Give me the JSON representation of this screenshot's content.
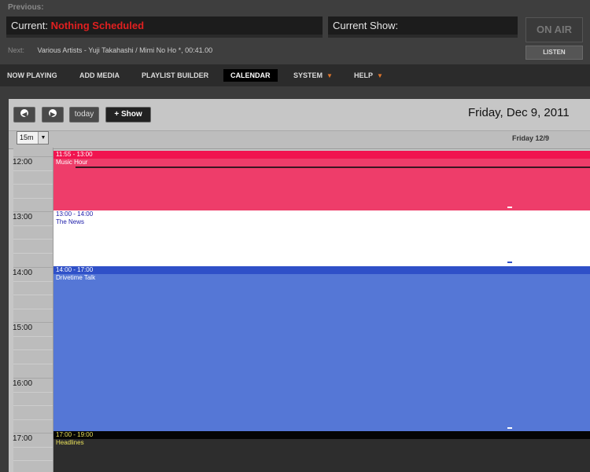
{
  "header": {
    "previous_label": "Previous:",
    "current_label": "Current:",
    "current_value": "Nothing Scheduled",
    "current_show_label": "Current Show:",
    "next_label": "Next:",
    "next_value": "Various Artists - Yuji Takahashi / Mimi No Ho *, 00:41.00",
    "on_air": "ON AIR",
    "listen": "LISTEN"
  },
  "menu": [
    {
      "label": "NOW PLAYING"
    },
    {
      "label": "ADD MEDIA"
    },
    {
      "label": "PLAYLIST BUILDER"
    },
    {
      "label": "CALENDAR",
      "active": true
    },
    {
      "label": "SYSTEM",
      "dropdown": true
    },
    {
      "label": "HELP",
      "dropdown": true
    }
  ],
  "toolbar": {
    "prev_icon": "prev-icon",
    "next_icon": "next-icon",
    "today": "today",
    "add_show": "Show",
    "date_title": "Friday, Dec 9, 2011"
  },
  "calendar": {
    "zoom": "15m",
    "day_header": "Friday 12/9",
    "hours": [
      "12:00",
      "13:00",
      "14:00",
      "15:00",
      "16:00",
      "17:00"
    ],
    "events": [
      {
        "time": "11:55 - 13:00",
        "title": "Music Hour",
        "color": "#ee3d6a",
        "head_color": "#f0144f",
        "text_color": "#ffffff"
      },
      {
        "time": "13:00 - 14:00",
        "title": "The News",
        "color": "#ffffff",
        "head_color": "#ffffff",
        "text_color": "#1a1aa8"
      },
      {
        "time": "14:00 - 17:00",
        "title": "Drivetime Talk",
        "color": "#5577d6",
        "head_color": "#2f50c8",
        "text_color": "#ffffff"
      },
      {
        "time": "17:00 - 19:00",
        "title": "Headlines",
        "color": "#2d2d2d",
        "head_color": "#050505",
        "text_color": "#e8e05a"
      }
    ]
  },
  "colors": {
    "accent_red": "#e02020",
    "caret_orange": "#e0762c"
  }
}
